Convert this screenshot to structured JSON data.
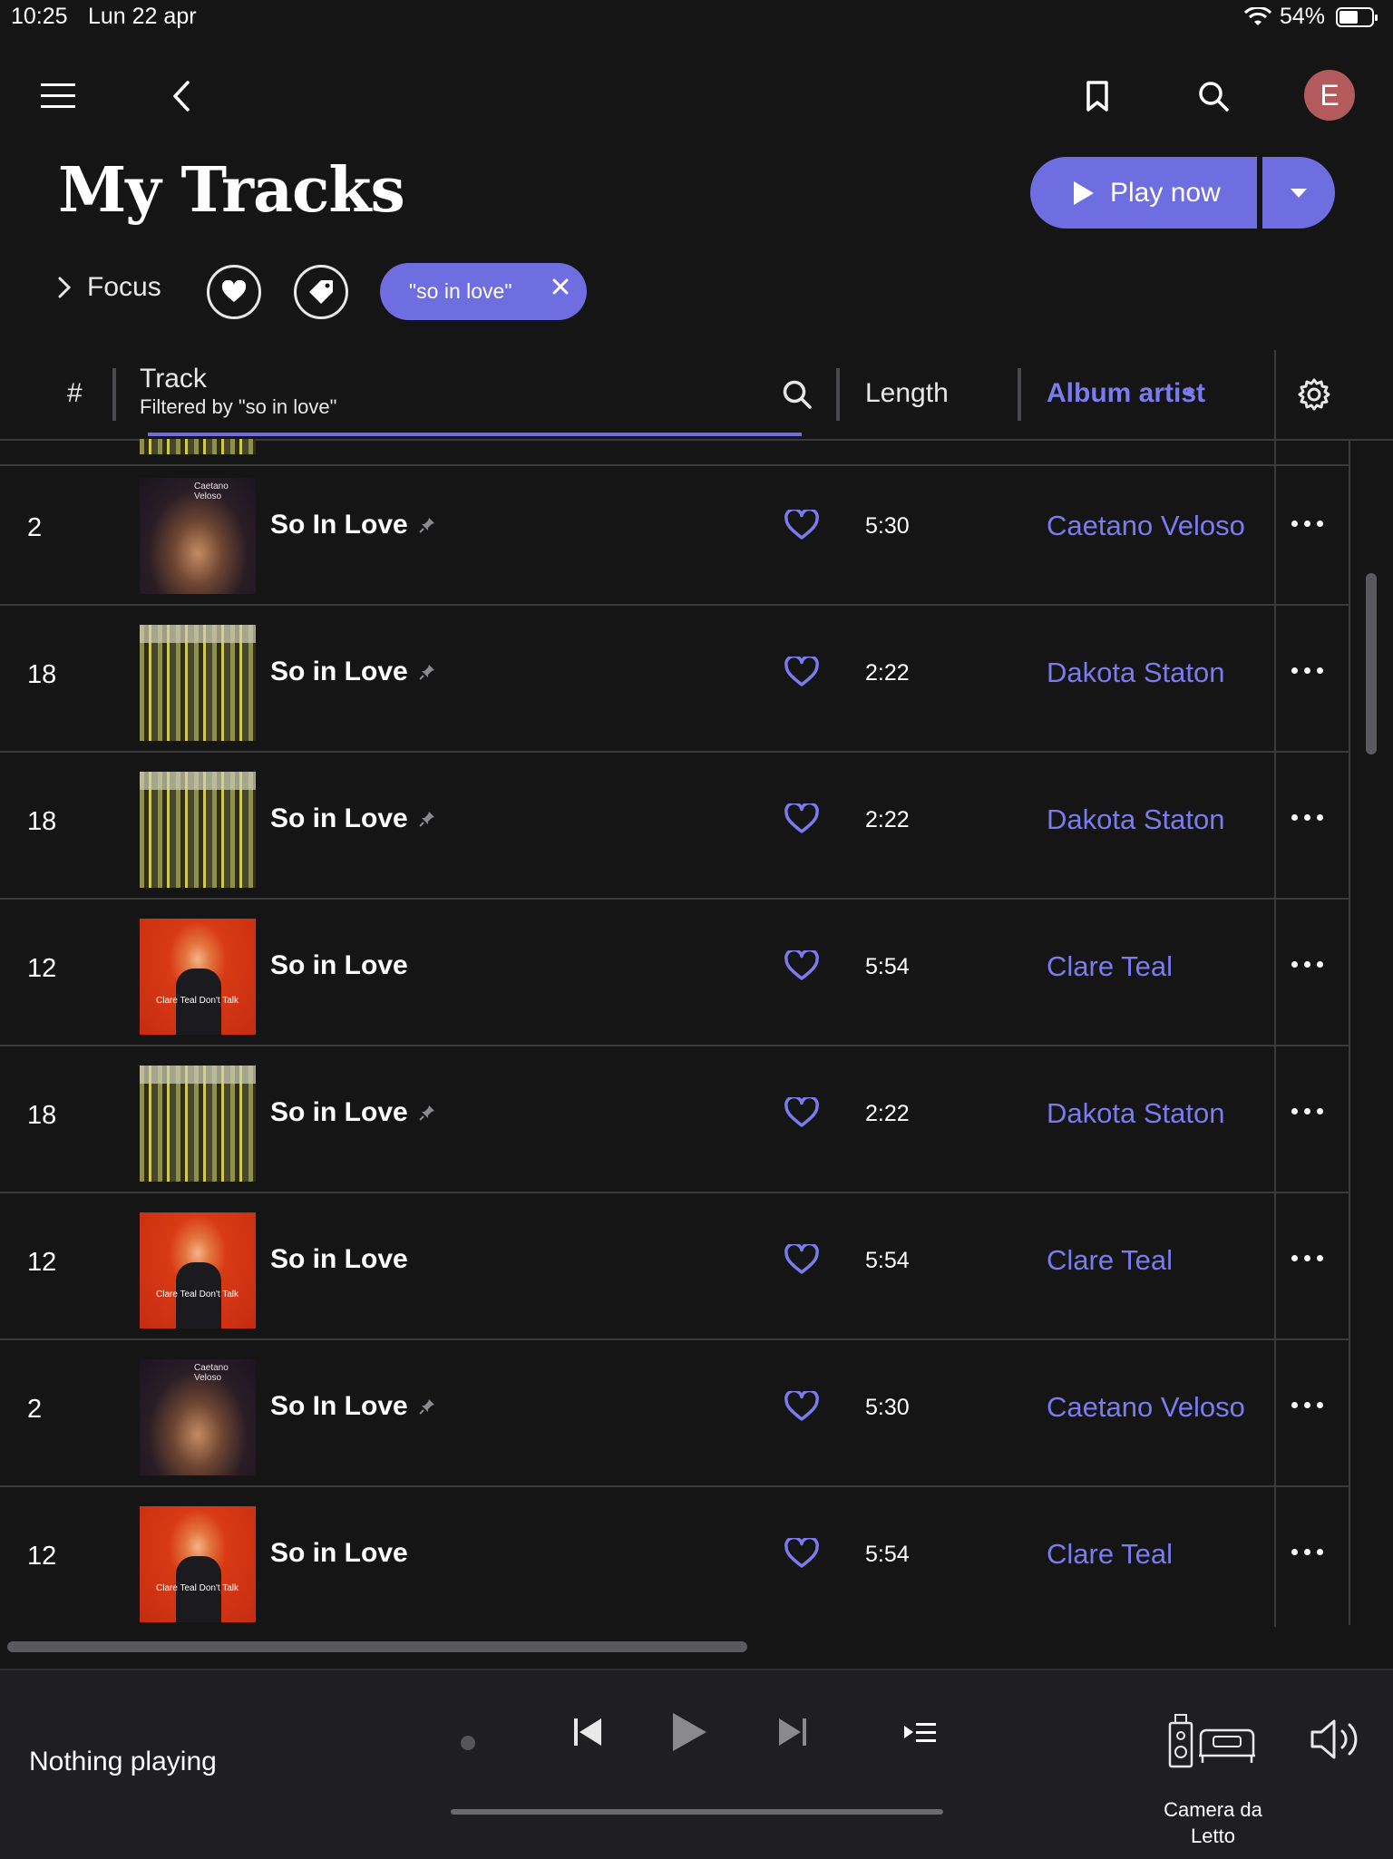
{
  "status_bar": {
    "time": "10:25",
    "date": "Lun 22 apr",
    "battery": "54%"
  },
  "header": {
    "title": "My Tracks",
    "play_label": "Play now"
  },
  "filters": {
    "focus_label": "Focus",
    "chip_label": "\"so in love\""
  },
  "table": {
    "col_num": "#",
    "col_track": "Track",
    "col_track_sub": "Filtered by \"so in love\"",
    "col_length": "Length",
    "col_artist": "Album artist",
    "rows": [
      {
        "num": "2",
        "title": "So In Love",
        "length": "5:30",
        "artist": "Caetano Veloso",
        "art": "caetano",
        "art_text": "Caetano Veloso",
        "pin": true
      },
      {
        "num": "18",
        "title": "So in Love",
        "length": "2:22",
        "artist": "Dakota Staton",
        "art": "dakota",
        "art_text": "",
        "pin": true
      },
      {
        "num": "18",
        "title": "So in Love",
        "length": "2:22",
        "artist": "Dakota Staton",
        "art": "dakota",
        "art_text": "",
        "pin": true
      },
      {
        "num": "12",
        "title": "So in Love",
        "length": "5:54",
        "artist": "Clare Teal",
        "art": "clare",
        "art_text": "Clare Teal Don't Talk",
        "pin": false
      },
      {
        "num": "18",
        "title": "So in Love",
        "length": "2:22",
        "artist": "Dakota Staton",
        "art": "dakota",
        "art_text": "",
        "pin": true
      },
      {
        "num": "12",
        "title": "So in Love",
        "length": "5:54",
        "artist": "Clare Teal",
        "art": "clare",
        "art_text": "Clare Teal Don't Talk",
        "pin": false
      },
      {
        "num": "2",
        "title": "So In Love",
        "length": "5:30",
        "artist": "Caetano Veloso",
        "art": "caetano",
        "art_text": "Caetano Veloso",
        "pin": true
      },
      {
        "num": "12",
        "title": "So in Love",
        "length": "5:54",
        "artist": "Clare Teal",
        "art": "clare",
        "art_text": "Clare Teal Don't Talk",
        "pin": false
      }
    ]
  },
  "player": {
    "now_playing": "Nothing playing",
    "zone_line1": "Camera da",
    "zone_line2": "Letto"
  },
  "colors": {
    "accent": "#6e6ee0",
    "background": "#151516",
    "avatar": "#b25a5c"
  },
  "icons": [
    "menu-icon",
    "back-icon",
    "bookmark-icon",
    "search-icon",
    "play-icon",
    "chevron-down-icon",
    "chevron-right-icon",
    "heart-icon",
    "tag-icon",
    "close-icon",
    "sort-asc-icon",
    "settings-icon",
    "pin-icon",
    "more-icon",
    "previous-icon",
    "next-icon",
    "queue-icon",
    "speaker-icon",
    "volume-icon"
  ]
}
